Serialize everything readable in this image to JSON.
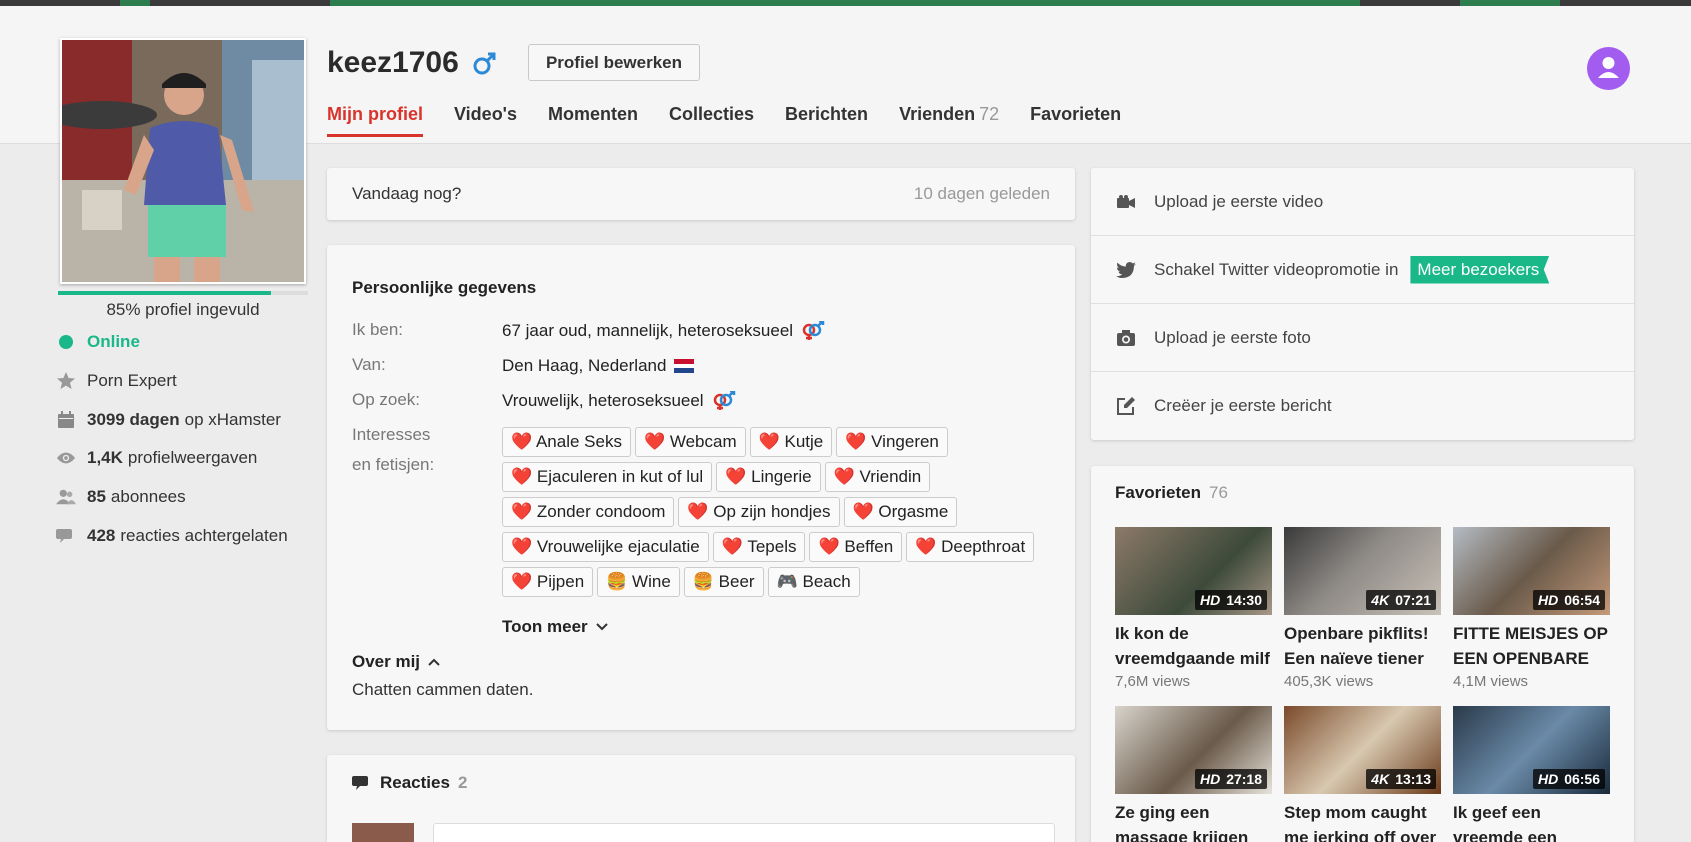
{
  "profile": {
    "username": "keez1706",
    "edit_label": "Profiel bewerken",
    "progress": 0.85,
    "progress_label": "85% profiel ingevuld",
    "accent": "#d9342b",
    "green": "#1ab889"
  },
  "tabs": [
    {
      "label": "Mijn profiel",
      "active": true
    },
    {
      "label": "Video's"
    },
    {
      "label": "Momenten"
    },
    {
      "label": "Collecties"
    },
    {
      "label": "Berichten"
    },
    {
      "label": "Vrienden",
      "count": "72"
    },
    {
      "label": "Favorieten"
    }
  ],
  "stats": {
    "online": "Online",
    "expert": "Porn Expert",
    "days_bold": "3099 dagen",
    "days_rest": "op xHamster",
    "views_bold": "1,4K",
    "views_rest": "profielweergaven",
    "subs_bold": "85",
    "subs_rest": "abonnees",
    "reacts_bold": "428",
    "reacts_rest": "reacties achtergelaten"
  },
  "status": {
    "text": "Vandaag nog?",
    "time": "10 dagen geleden"
  },
  "personal": {
    "title": "Persoonlijke gegevens",
    "iam_label": "Ik ben:",
    "iam_value": "67 jaar oud, mannelijk, heteroseksueel",
    "from_label": "Van:",
    "from_value": "Den Haag, Nederland",
    "seek_label": "Op zoek:",
    "seek_value": "Vrouwelijk, heteroseksueel",
    "interests_label_1": "Interesses",
    "interests_label_2": "en fetisjen:",
    "tags": [
      "❤️ Anale Seks",
      "❤️ Webcam",
      "❤️ Kutje",
      "❤️ Vingeren",
      "❤️ Ejaculeren in kut of lul",
      "❤️ Lingerie",
      "❤️ Vriendin",
      "❤️ Zonder condoom",
      "❤️ Op zijn hondjes",
      "❤️ Orgasme",
      "❤️ Vrouwelijke ejaculatie",
      "❤️ Tepels",
      "❤️ Beffen",
      "❤️ Deepthroat",
      "❤️ Pijpen",
      "🍔 Wine",
      "🍔 Beer",
      "🎮 Beach"
    ],
    "show_more": "Toon meer",
    "about_title": "Over mij",
    "about_text": "Chatten cammen daten."
  },
  "reactions": {
    "title": "Reacties",
    "count": "2"
  },
  "actions": [
    {
      "label": "Upload je eerste video",
      "icon": "video-camera-icon"
    },
    {
      "label": "Schakel Twitter videopromotie in",
      "icon": "twitter-icon",
      "promo": "Meer bezoekers"
    },
    {
      "label": "Upload je eerste foto",
      "icon": "camera-icon"
    },
    {
      "label": "Creëer je eerste bericht",
      "icon": "edit-icon"
    }
  ],
  "favorites": {
    "title": "Favorieten",
    "count": "76",
    "videos": [
      {
        "quality": "HD",
        "duration": "14:30",
        "title": "Ik kon de vreemdgaande milf",
        "views": "7,6M views"
      },
      {
        "quality": "4K",
        "duration": "07:21",
        "title": "Openbare pikflits! Een naïeve tiener",
        "views": "405,3K views"
      },
      {
        "quality": "HD",
        "duration": "06:54",
        "title": "FITTE MEISJES OP EEN OPENBARE",
        "views": "4,1M views"
      },
      {
        "quality": "HD",
        "duration": "27:18",
        "title": "Ze ging een massage krijgen",
        "views": ""
      },
      {
        "quality": "4K",
        "duration": "13:13",
        "title": "Step mom caught me jerking off over",
        "views": ""
      },
      {
        "quality": "HD",
        "duration": "06:56",
        "title": "Ik geef een vreemde een",
        "views": ""
      }
    ]
  }
}
